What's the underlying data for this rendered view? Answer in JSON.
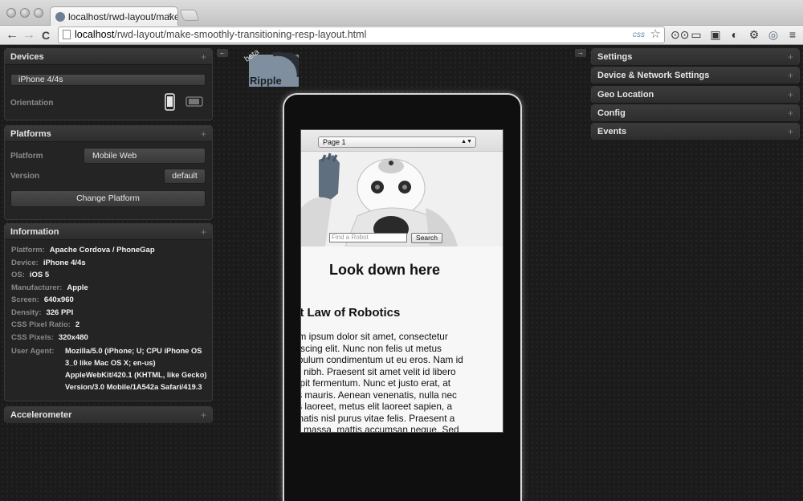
{
  "browser": {
    "tab_title": "localhost/rwd-layout/make",
    "tab_close": "×",
    "url_host": "localhost",
    "url_path": "/rwd-layout/make-smoothly-transitioning-resp-layout.html",
    "css_badge": "css",
    "back": "←",
    "forward": "→",
    "reload": "C"
  },
  "left_panels": {
    "devices": {
      "title": "Devices",
      "device": "iPhone 4/4s",
      "orientation_label": "Orientation"
    },
    "platforms": {
      "title": "Platforms",
      "platform_label": "Platform",
      "platform_value": "Mobile Web",
      "version_label": "Version",
      "version_value": "default",
      "change_button": "Change Platform"
    },
    "information": {
      "title": "Information",
      "rows": [
        {
          "k": "Platform:",
          "v": "Apache Cordova / PhoneGap"
        },
        {
          "k": "Device:",
          "v": "iPhone 4/4s"
        },
        {
          "k": "OS:",
          "v": "iOS 5"
        },
        {
          "k": "Manufacturer:",
          "v": "Apple"
        },
        {
          "k": "Screen:",
          "v": "640x960"
        },
        {
          "k": "Density:",
          "v": "326 PPI"
        },
        {
          "k": "CSS Pixel Ratio:",
          "v": "2"
        },
        {
          "k": "CSS Pixels:",
          "v": "320x480"
        }
      ],
      "ua_label": "User Agent:",
      "ua_lines": [
        "Mozilla/5.0 (iPhone; U; CPU iPhone OS",
        "3_0 like Mac OS X; en-us)",
        "AppleWebKit/420.1 (KHTML, like Gecko)",
        "Version/3.0 Mobile/1A542a Safari/419.3"
      ]
    },
    "accelerometer": {
      "title": "Accelerometer"
    }
  },
  "right_panels": [
    {
      "title": "Settings"
    },
    {
      "title": "Device & Network Settings"
    },
    {
      "title": "Geo Location"
    },
    {
      "title": "Config"
    },
    {
      "title": "Events"
    }
  ],
  "plus_glyph": "+",
  "arrow_left": "←",
  "arrow_right": "→",
  "logo": {
    "word": "Ripple",
    "tag": "beta"
  },
  "phone_page": {
    "select_value": "Page 1",
    "search_placeholder": "Find a Robot",
    "search_button": "Search",
    "heading": "Look down here",
    "subheading": "st Law of Robotics",
    "paragraph_lines": [
      "em ipsum dolor sit amet, consectetur",
      "piscing elit. Nunc non felis ut metus",
      "tibulum condimentum ut eu eros. Nam id",
      "m nibh. Praesent sit amet velit id libero",
      "cipit fermentum. Nunc et justo erat, at",
      "lis mauris. Aenean venenatis, nulla nec",
      "lis laoreet, metus elit laoreet sapien, a",
      "enatis nisl purus vitae felis. Praesent a",
      "m massa, mattis accumsan neque. Sed"
    ]
  }
}
